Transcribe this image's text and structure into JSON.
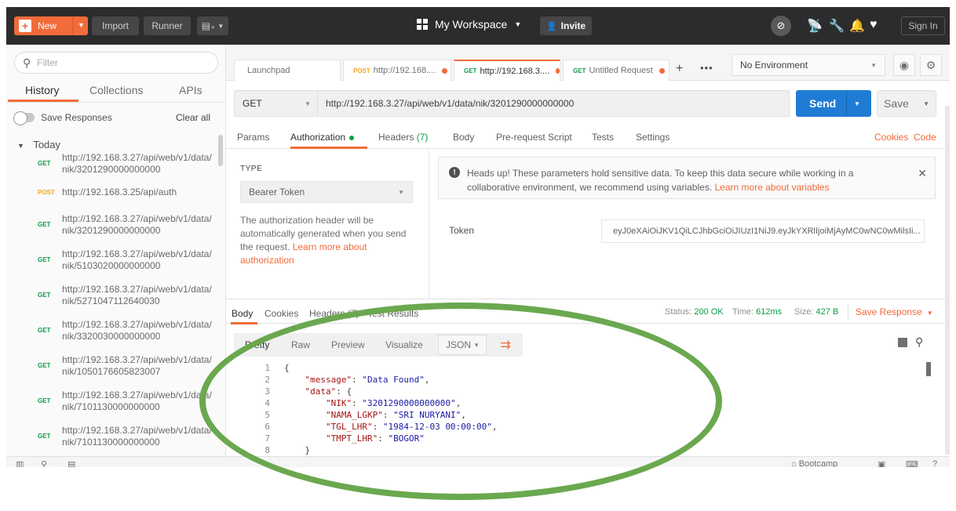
{
  "header": {
    "new_label": "New",
    "import_label": "Import",
    "runner_label": "Runner",
    "workspace_label": "My Workspace",
    "invite_label": "Invite",
    "signin_label": "Sign In"
  },
  "sidebar": {
    "filter_placeholder": "Filter",
    "tabs": [
      "History",
      "Collections",
      "APIs"
    ],
    "save_responses_label": "Save Responses",
    "clear_all_label": "Clear all",
    "group_label": "Today",
    "history": [
      {
        "method": "GET",
        "url": "http://192.168.3.27/api/web/v1/data/nik/3201290000000000"
      },
      {
        "method": "POST",
        "url": "http://192.168.3.25/api/auth"
      },
      {
        "method": "GET",
        "url": "http://192.168.3.27/api/web/v1/data/nik/3201290000000000"
      },
      {
        "method": "GET",
        "url": "http://192.168.3.27/api/web/v1/data/nik/5103020000000000"
      },
      {
        "method": "GET",
        "url": "http://192.168.3.27/api/web/v1/data/nik/5271047112640030"
      },
      {
        "method": "GET",
        "url": "http://192.168.3.27/api/web/v1/data/nik/3320030000000000"
      },
      {
        "method": "GET",
        "url": "http://192.168.3.27/api/web/v1/data/nik/1050176605823007"
      },
      {
        "method": "GET",
        "url": "http://192.168.3.27/api/web/v1/data/nik/7101130000000000"
      },
      {
        "method": "GET",
        "url": "http://192.168.3.27/api/web/v1/data/nik/7101130000000000"
      }
    ]
  },
  "tabs": {
    "launchpad_label": "Launchpad",
    "items": [
      {
        "method": "POST",
        "label": "http://192.168...."
      },
      {
        "method": "GET",
        "label": "http://192.168.3...."
      },
      {
        "method": "GET",
        "label": "Untitled Request"
      }
    ],
    "environment_label": "No Environment"
  },
  "request": {
    "method": "GET",
    "url": "http://192.168.3.27/api/web/v1/data/nik/3201290000000000",
    "send_label": "Send",
    "save_label": "Save",
    "tabs": {
      "params": "Params",
      "authorization": "Authorization",
      "headers": "Headers",
      "headers_count": "(7)",
      "body": "Body",
      "prerequest": "Pre-request Script",
      "tests": "Tests",
      "settings": "Settings"
    },
    "cookies_label": "Cookies",
    "code_label": "Code"
  },
  "auth": {
    "type_label": "TYPE",
    "type_value": "Bearer Token",
    "description": "The authorization header will be automatically generated when you send the request.",
    "learn_more": "Learn more about authorization",
    "heads_up": "Heads up! These parameters hold sensitive data. To keep this data secure while working in a collaborative environment, we recommend using variables.",
    "heads_up_link": "Learn more about variables",
    "token_label": "Token",
    "token_value": "eyJ0eXAiOiJKV1QiLCJhbGciOiJIUzI1NiJ9.eyJkYXRlIjoiMjAyMC0wNC0wMilsIi..."
  },
  "response": {
    "tabs": [
      "Body",
      "Cookies",
      "Headers (7)",
      "Test Results"
    ],
    "status_label": "Status:",
    "status_value": "200 OK",
    "time_label": "Time:",
    "time_value": "612ms",
    "size_label": "Size:",
    "size_value": "427 B",
    "save_response_label": "Save Response",
    "view_tabs": [
      "Pretty",
      "Raw",
      "Preview",
      "Visualize"
    ],
    "format": "JSON",
    "body_lines": [
      {
        "n": "1",
        "indent": "",
        "text": "{"
      },
      {
        "n": "2",
        "indent": "    ",
        "key": "\"message\"",
        "val": "\"Data Found\"",
        "end": ","
      },
      {
        "n": "3",
        "indent": "    ",
        "key": "\"data\"",
        "val": "",
        "end": "{"
      },
      {
        "n": "4",
        "indent": "        ",
        "key": "\"NIK\"",
        "val": "\"3201290000000000\"",
        "end": ","
      },
      {
        "n": "5",
        "indent": "        ",
        "key": "\"NAMA_LGKP\"",
        "val": "\"SRI NURYANI\"",
        "end": ","
      },
      {
        "n": "6",
        "indent": "        ",
        "key": "\"TGL_LHR\"",
        "val": "\"1984-12-03 00:00:00\"",
        "end": ","
      },
      {
        "n": "7",
        "indent": "        ",
        "key": "\"TMPT_LHR\"",
        "val": "\"BOGOR\"",
        "end": ""
      },
      {
        "n": "8",
        "indent": "    ",
        "text": "}"
      }
    ]
  },
  "statusbar": {
    "bootcamp_label": "Bootcamp"
  },
  "colors": {
    "accent": "#f26b3a",
    "send_blue": "#1f7cd4",
    "get_green": "#0c9c46",
    "post_orange": "#f5a623",
    "annotation_green": "#6aa84f"
  }
}
